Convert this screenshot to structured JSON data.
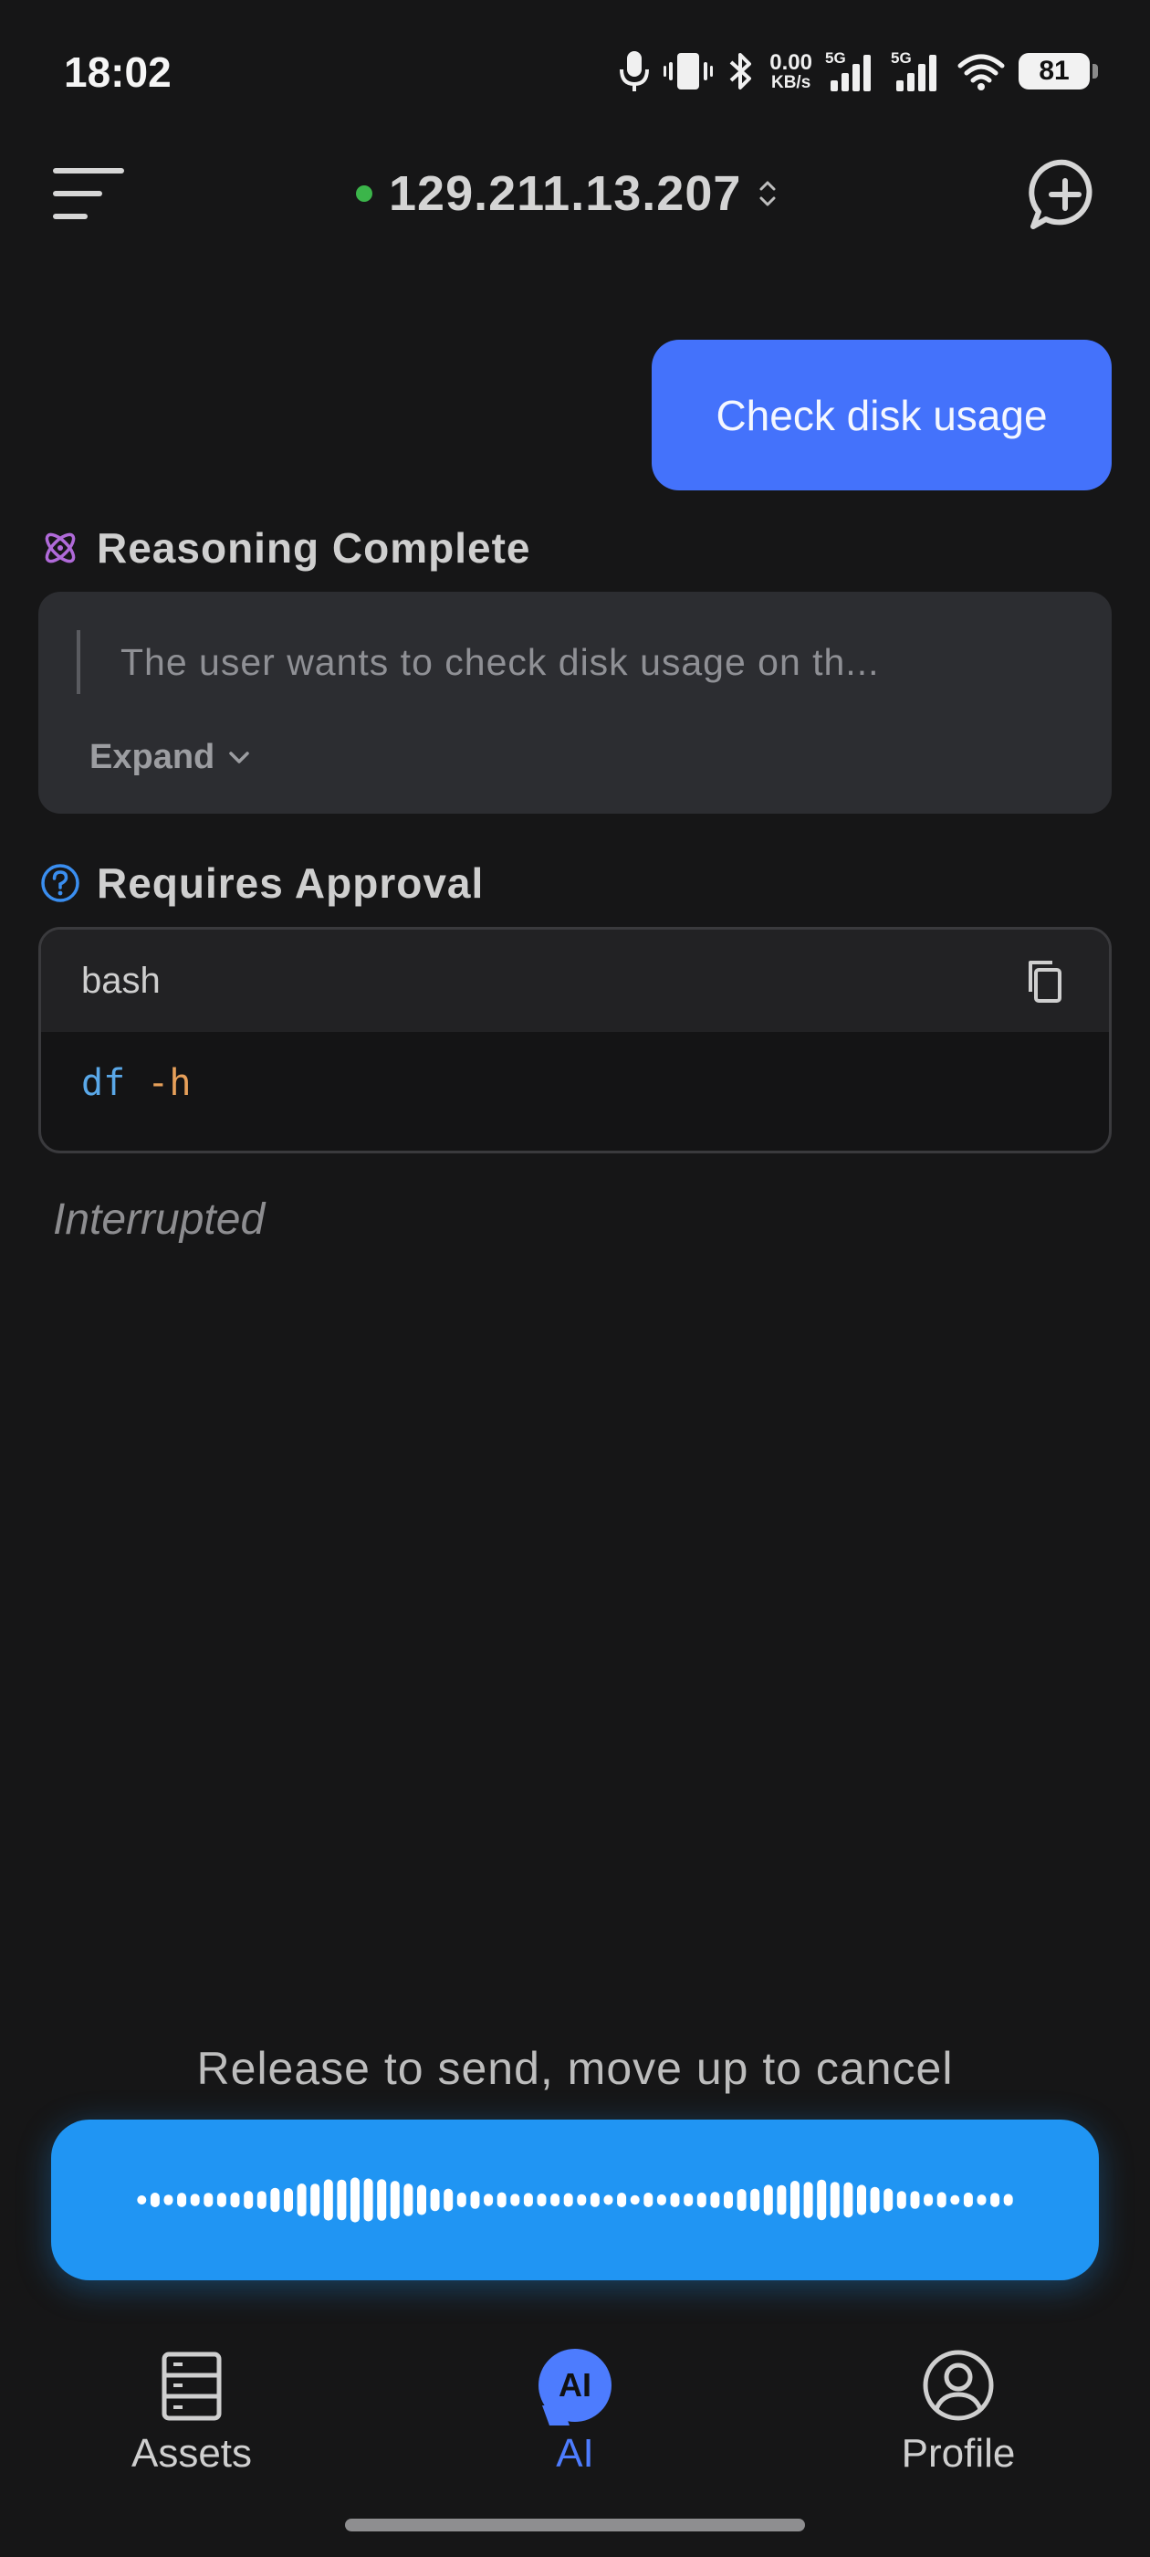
{
  "status_bar": {
    "time": "18:02",
    "net_speed_value": "0.00",
    "net_speed_unit": "KB/s",
    "signal1_label": "5G",
    "signal2_label": "5G",
    "battery": "81",
    "icons": [
      "microphone-icon",
      "vibrate-icon",
      "bluetooth-icon",
      "signal-icon",
      "signal-icon",
      "wifi-icon",
      "battery-icon"
    ]
  },
  "header": {
    "server_ip": "129.211.13.207",
    "online_color": "#3bb54a",
    "icons": [
      "menu-icon",
      "updown-chevron-icon",
      "new-chat-icon"
    ]
  },
  "chat": {
    "user_message": "Check disk usage",
    "reasoning": {
      "title": "Reasoning Complete",
      "preview": "The user wants to check disk usage on th...",
      "expand_label": "Expand",
      "accent": "#b06ad9"
    },
    "approval": {
      "title": "Requires Approval",
      "accent": "#3a8ef0"
    },
    "code_block": {
      "language": "bash",
      "command": "df",
      "argument": " -h"
    },
    "status_note": "Interrupted"
  },
  "voice": {
    "hint": "Release to send, move up to cancel",
    "color": "#2095f3"
  },
  "bottom_nav": {
    "items": [
      {
        "label": "Assets",
        "icon": "server-icon",
        "active": false
      },
      {
        "label": "AI",
        "icon": "ai-chat-icon",
        "badge_text": "AI",
        "active": true
      },
      {
        "label": "Profile",
        "icon": "profile-icon",
        "active": false
      }
    ],
    "active_color": "#4d7cfe"
  }
}
